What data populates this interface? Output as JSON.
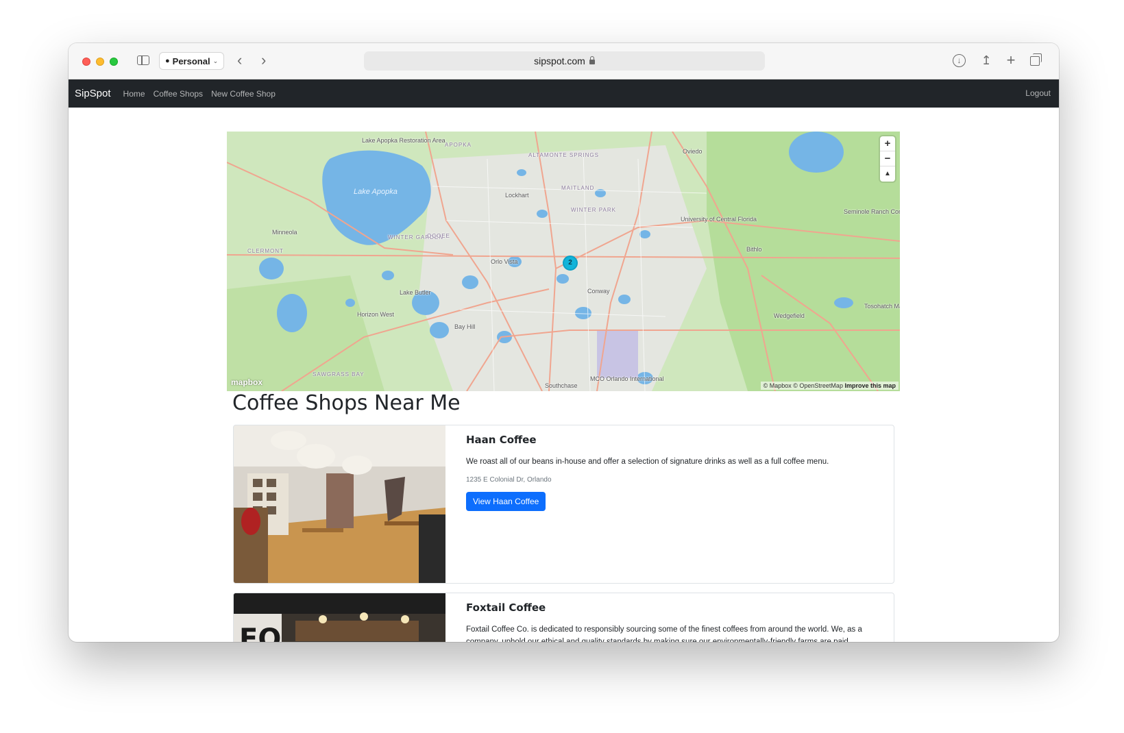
{
  "browser": {
    "profile_label": "Personal",
    "url": "sipspot.com"
  },
  "navbar": {
    "brand": "SipSpot",
    "links": [
      "Home",
      "Coffee Shops",
      "New Coffee Shop"
    ],
    "logout": "Logout"
  },
  "map": {
    "cluster_count": "2",
    "logo": "mapbox",
    "attribution": "© Mapbox © OpenStreetMap",
    "improve_link": "Improve this map",
    "zoom_in": "+",
    "zoom_out": "−",
    "compass": "▲",
    "labels": {
      "lake_apopka": "Lake Apopka",
      "lake_apopka_restoration": "Lake Apopka Restoration Area",
      "apopka": "APOPKA",
      "altamonte": "ALTAMONTE SPRINGS",
      "oviedo": "Oviedo",
      "lockhart": "Lockhart",
      "maitland": "MAITLAND",
      "winter_park": "WINTER PARK",
      "ucf": "University of Central Florida",
      "seminole_ranch": "Seminole Ranch Conservation Are",
      "minneola": "Minneola",
      "clermont": "CLERMONT",
      "winter_garden": "WINTER GARDEN",
      "ocoee": "OCOEE",
      "orlo_vista": "Orlo Vista",
      "bithlo": "Bithlo",
      "lake_butler": "Lake Butler",
      "conway": "Conway",
      "horizon_west": "Horizon West",
      "bay_hill": "Bay Hill",
      "wedgefield": "Wedgefield",
      "tosohatchee": "Tosohatch Managem",
      "sawgrass_bay": "SAWGRASS BAY",
      "southchase": "Southchase",
      "mco": "MCO Orlando International"
    }
  },
  "page_title": "Coffee Shops Near Me",
  "shops": [
    {
      "name": "Haan Coffee",
      "description": "We roast all of our beans in-house and offer a selection of signature drinks as well as a full coffee menu.",
      "address": "1235 E Colonial Dr, Orlando",
      "button": "View Haan Coffee"
    },
    {
      "name": "Foxtail Coffee",
      "description": "Foxtail Coffee Co. is dedicated to responsibly sourcing some of the finest coffees from around the world. We, as a company, uphold our ethical and quality standards by making sure our environmentally-friendly farms are paid"
    }
  ]
}
